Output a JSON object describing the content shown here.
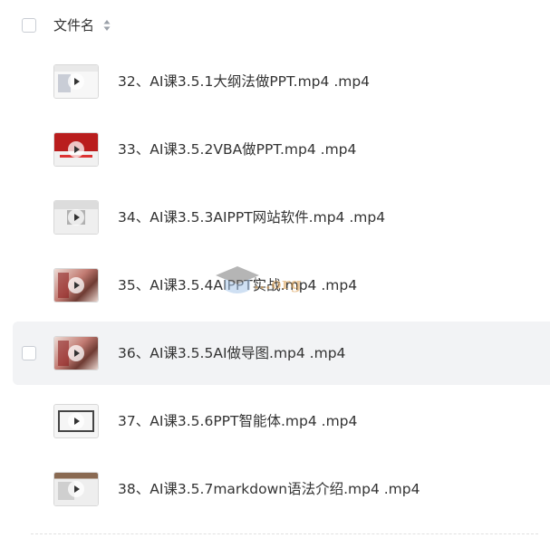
{
  "header": {
    "column_label": "文件名"
  },
  "files": [
    {
      "name": "32、AI课3.5.1大纲法做PPT.mp4 .mp4",
      "thumb": "doc"
    },
    {
      "name": "33、AI课3.5.2VBA做PPT.mp4 .mp4",
      "thumb": "red"
    },
    {
      "name": "34、AI课3.5.3AIPPT网站软件.mp4 .mp4",
      "thumb": "gray"
    },
    {
      "name": "35、AI课3.5.4AIPPT实战.mp4 .mp4",
      "thumb": "anime"
    },
    {
      "name": "36、AI课3.5.5AI做导图.mp4 .mp4",
      "thumb": "anime",
      "hovered": true
    },
    {
      "name": "37、AI课3.5.6PPT智能体.mp4 .mp4",
      "thumb": "frame"
    },
    {
      "name": "38、AI课3.5.7markdown语法介绍.mp4 .mp4",
      "thumb": "md"
    }
  ],
  "watermark": {
    "text": "...org",
    "icon": "graduation-cap-icon"
  }
}
